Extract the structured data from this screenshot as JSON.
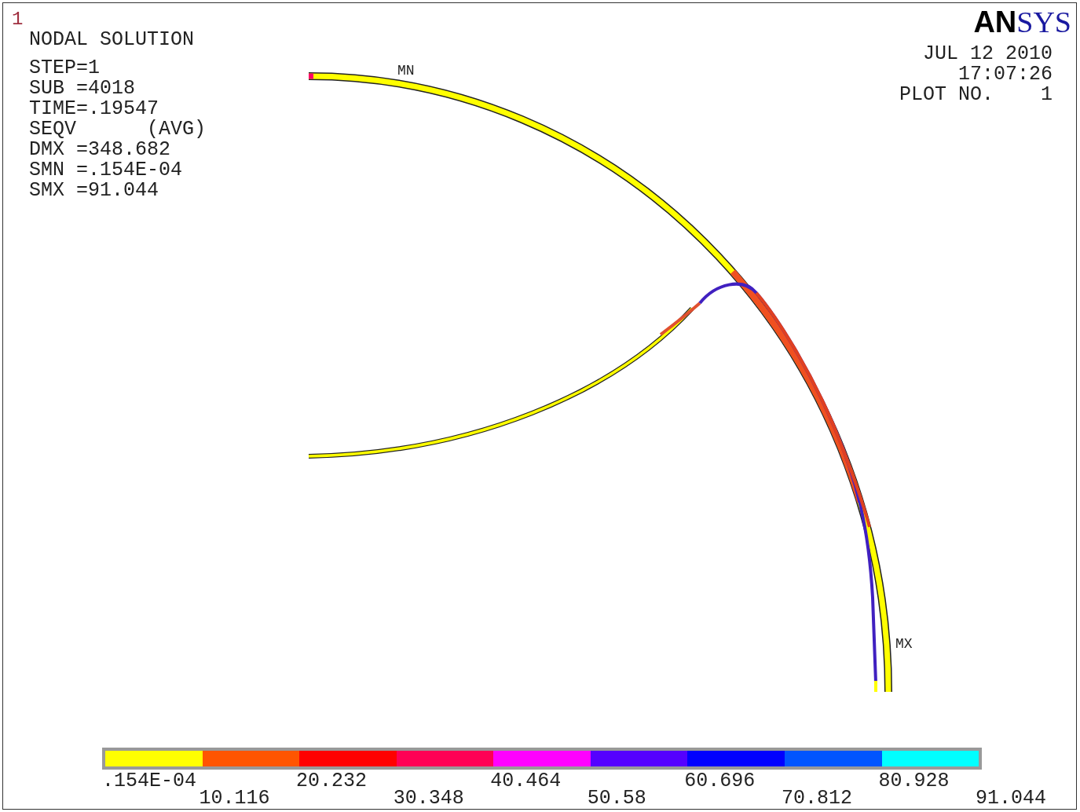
{
  "window_number": "1",
  "title": "NODAL SOLUTION",
  "info_lines": [
    "STEP=1",
    "SUB =4018",
    "TIME=.19547",
    "SEQV      (AVG)",
    "DMX =348.682",
    "SMN =.154E-04",
    "SMX =91.044"
  ],
  "logo": "**AN**SYS",
  "stamp_lines": [
    "JUL 12 2010",
    "17:07:26",
    "PLOT NO.    1"
  ],
  "markers": [
    {
      "kind": "min",
      "label": "MN"
    },
    {
      "kind": "max",
      "label": "MX"
    }
  ],
  "legend": {
    "bands": [
      {
        "color": "#ffff00"
      },
      {
        "color": "#ff5500"
      },
      {
        "color": "#ff0000"
      },
      {
        "color": "#ff0055"
      },
      {
        "color": "#ff00ff"
      },
      {
        "color": "#5500ff"
      },
      {
        "color": "#0000ff"
      },
      {
        "color": "#0055ff"
      },
      {
        "color": "#00ffff"
      }
    ],
    "labels": [
      ".154E-04",
      "10.116",
      "20.232",
      "30.348",
      "40.464",
      "50.58",
      "60.696",
      "70.812",
      "80.928",
      "91.044"
    ]
  }
}
